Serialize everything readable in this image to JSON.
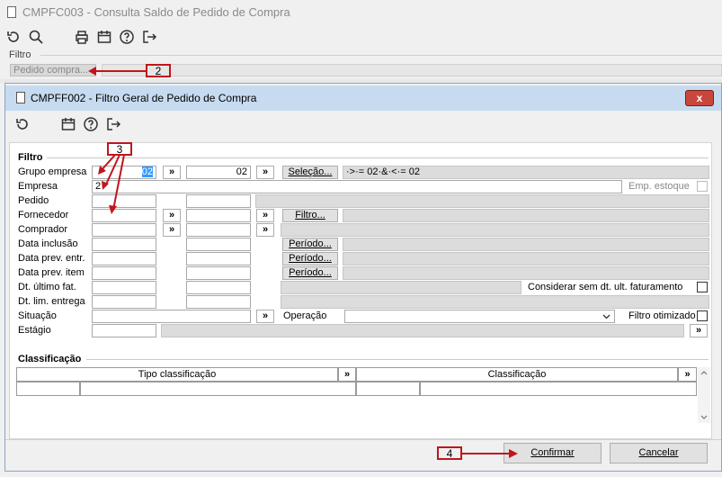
{
  "background_window": {
    "title": "CMPFC003 - Consulta Saldo de Pedido de Compra",
    "filter_label": "Filtro",
    "pedido_button": "Pedido compra..."
  },
  "dialog": {
    "title": "CMPFF002 - Filtro Geral de Pedido de Compra",
    "close_glyph": "x",
    "filter_group": "Filtro",
    "classification_group": "Classificação"
  },
  "fields": {
    "grupo_empresa": {
      "label": "Grupo empresa",
      "from": "02",
      "to": "02",
      "selection_button": "Seleção...",
      "selection_value": "·>·= 02·&·<·= 02"
    },
    "empresa": {
      "label": "Empresa",
      "value": "2",
      "emp_estoque_label": "Emp. estoque"
    },
    "pedido": {
      "label": "Pedido"
    },
    "fornecedor": {
      "label": "Fornecedor",
      "filter_button": "Filtro..."
    },
    "comprador": {
      "label": "Comprador"
    },
    "data_inclusao": {
      "label": "Data inclusão",
      "periodo_button": "Período..."
    },
    "data_prev_entr": {
      "label": "Data prev. entr.",
      "periodo_button": "Período..."
    },
    "data_prev_item": {
      "label": "Data prev. item",
      "periodo_button": "Período..."
    },
    "dt_ultimo_fat": {
      "label": "Dt. último fat.",
      "considerar_label": "Considerar sem dt. ult. faturamento"
    },
    "dt_lim_entrega": {
      "label": "Dt. lim. entrega"
    },
    "situacao": {
      "label": "Situação",
      "operacao_label": "Operação",
      "filtro_otimizado_label": "Filtro otimizado"
    },
    "estagio": {
      "label": "Estágio"
    }
  },
  "double_arrow": "»",
  "classification_table": {
    "headers": [
      "Tipo classificação",
      "Classificação"
    ]
  },
  "buttons": {
    "confirm": "Confirmar",
    "cancel": "Cancelar"
  },
  "annotations": {
    "two": "2",
    "three": "3",
    "four": "4"
  },
  "colors": {
    "annotation": "#c0161b",
    "title_bar": "#c6dbef",
    "close": "#c9463d",
    "selection_highlight": "#3399ff"
  }
}
